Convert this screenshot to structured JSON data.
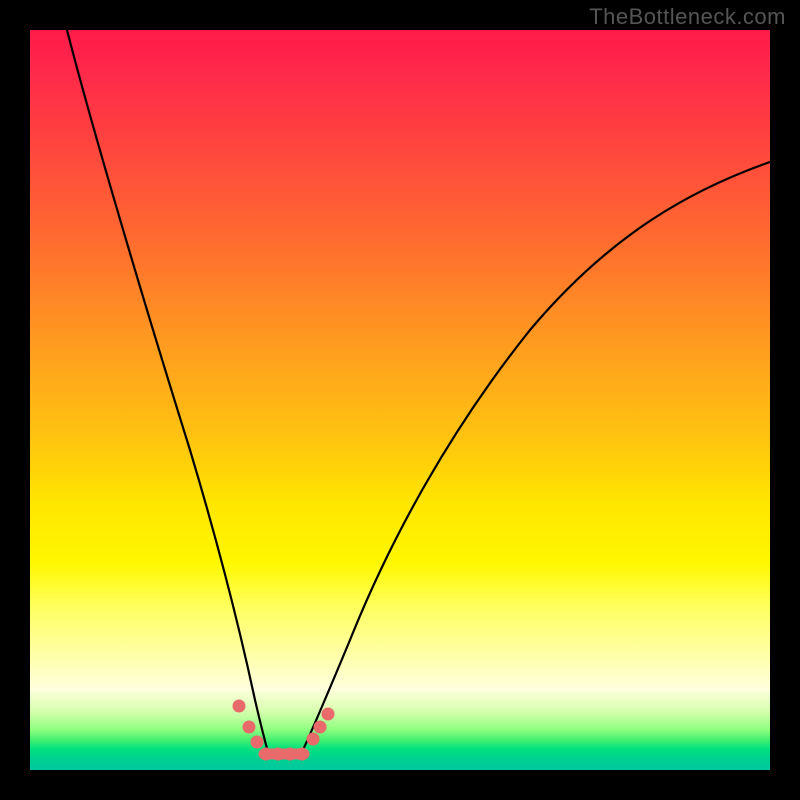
{
  "watermark": "TheBottleneck.com",
  "chart_data": {
    "type": "line",
    "title": "",
    "xlabel": "",
    "ylabel": "",
    "xlim": [
      0,
      100
    ],
    "ylim": [
      0,
      100
    ],
    "grid": false,
    "legend_position": "none",
    "series": [
      {
        "name": "left-curve",
        "x": [
          5,
          8,
          12,
          16,
          20,
          24,
          27,
          29,
          30.5,
          31.5
        ],
        "y": [
          100,
          90,
          75,
          58,
          40,
          22,
          11,
          5,
          2.5,
          1.5
        ]
      },
      {
        "name": "right-curve",
        "x": [
          36.5,
          38,
          40,
          44,
          50,
          58,
          68,
          80,
          92,
          100
        ],
        "y": [
          1.5,
          3,
          6,
          14,
          28,
          44,
          58,
          70,
          78,
          82
        ]
      }
    ],
    "valley_segment": {
      "x": [
        31.5,
        36.5
      ],
      "y": [
        1.2,
        1.2
      ]
    },
    "markers": [
      {
        "series": "left-curve",
        "x": 28.0,
        "y": 8.0
      },
      {
        "series": "left-curve",
        "x": 29.5,
        "y": 5.0
      },
      {
        "series": "left-curve",
        "x": 30.5,
        "y": 3.0
      },
      {
        "series": "valley",
        "x": 32.0,
        "y": 1.2
      },
      {
        "series": "valley",
        "x": 33.5,
        "y": 1.2
      },
      {
        "series": "valley",
        "x": 35.0,
        "y": 1.2
      },
      {
        "series": "valley",
        "x": 36.5,
        "y": 1.2
      },
      {
        "series": "right-curve",
        "x": 38.0,
        "y": 3.5
      },
      {
        "series": "right-curve",
        "x": 39.0,
        "y": 5.0
      },
      {
        "series": "right-curve",
        "x": 40.0,
        "y": 6.5
      }
    ],
    "gradient_colors": {
      "top": "#ff1a4a",
      "mid_upper": "#ff9a20",
      "mid": "#ffe600",
      "mid_lower": "#ffffb0",
      "bottom": "#00c8a0"
    }
  }
}
